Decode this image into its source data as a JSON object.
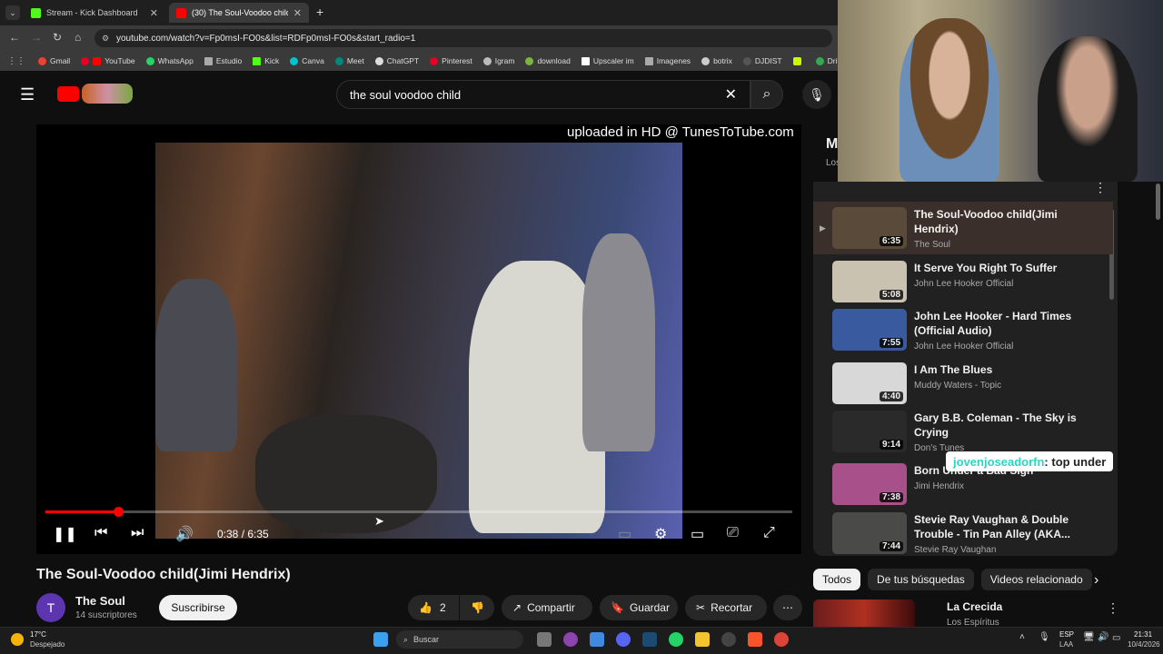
{
  "tabs": [
    {
      "label": "Stream - Kick Dashboard",
      "active": false
    },
    {
      "label": "(30) The Soul-Voodoo child",
      "active": true
    }
  ],
  "new_tab_label": "+",
  "url": "youtube.com/watch?v=Fp0msI-FO0s&list=RDFp0msI-FO0s&start_radio=1",
  "bookmarks": [
    "Gmail",
    "YouTube",
    "WhatsApp",
    "Estudio",
    "Kick",
    "Canva",
    "Meet",
    "ChatGPT",
    "Pinterest",
    "Igram",
    "download",
    "Upscaler im",
    "Imagenes",
    "botrix",
    "DJDIST",
    "Drive"
  ],
  "search": {
    "value": "the soul voodoo child"
  },
  "player": {
    "overlay_text": "uploaded in HD @ TunesToTube.com",
    "time": "0:38 / 6:35",
    "progress": 0.097
  },
  "video": {
    "title": "The Soul-Voodoo child(Jimi Hendrix)",
    "channel": "The Soul",
    "channel_initial": "T",
    "subscribers": "14 suscriptores",
    "subscribe_label": "Suscribirse",
    "likes": "2",
    "share_label": "Compartir",
    "save_label": "Guardar",
    "clip_label": "Recortar"
  },
  "playlist_header": {
    "letter": "M",
    "sub": "Los"
  },
  "playlist": [
    {
      "title": "The Soul-Voodoo child(Jimi Hendrix)",
      "channel": "The Soul",
      "duration": "6:35",
      "current": true,
      "thumb": "#5a4a3a"
    },
    {
      "title": "It Serve You Right To Suffer",
      "channel": "John Lee Hooker Official",
      "duration": "5:08",
      "current": false,
      "thumb": "#c9c2b0"
    },
    {
      "title": "John Lee Hooker - Hard Times (Official Audio)",
      "channel": "John Lee Hooker Official",
      "duration": "7:55",
      "current": false,
      "thumb": "#3a5aa0"
    },
    {
      "title": "I Am The Blues",
      "channel": "Muddy Waters - Topic",
      "duration": "4:40",
      "current": false,
      "thumb": "#d8d8d8"
    },
    {
      "title": "Gary B.B. Coleman - The Sky is Crying",
      "channel": "Don's Tunes",
      "duration": "9:14",
      "current": false,
      "thumb": "#2a2a2a"
    },
    {
      "title": "Born Under a Bad Sign",
      "channel": "Jimi Hendrix",
      "duration": "7:38",
      "current": false,
      "thumb": "#a8508a"
    },
    {
      "title": "Stevie Ray Vaughan & Double Trouble - Tin Pan Alley (AKA...",
      "channel": "Stevie Ray Vaughan",
      "duration": "7:44",
      "current": false,
      "thumb": "#4a4a48"
    }
  ],
  "chips": [
    "Todos",
    "De tus búsquedas",
    "Videos relacionado"
  ],
  "recommended": {
    "title": "La Crecida",
    "channel": "Los Espíritus"
  },
  "chat_overlay": {
    "user": "jovenjoseadorfn",
    "message": " : top under"
  },
  "taskbar": {
    "weather_temp": "17°C",
    "weather_desc": "Despejado",
    "search_label": "Buscar",
    "lang": "ESP",
    "lang2": "LAA",
    "clock_time": "21:31",
    "clock_date": "10/4/2026"
  },
  "colors": {
    "accent": "#ff0000",
    "bg": "#0f0f0f"
  }
}
